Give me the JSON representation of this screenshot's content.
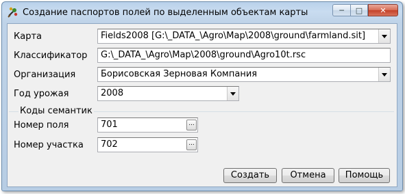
{
  "window": {
    "title": "Создание паспортов полей по выделенным объектам карты",
    "min_symbol": "─",
    "max_symbol": "□",
    "close_symbol": "✕"
  },
  "form": {
    "map": {
      "label": "Карта",
      "value": "Fields2008 [G:\\_DATA_\\Agro\\Map\\2008\\ground\\farmland.sit]"
    },
    "classifier": {
      "label": "Классификатор",
      "value": "G:\\_DATA_\\Agro\\Map\\2008\\ground\\Agro10t.rsc"
    },
    "organization": {
      "label": "Организация",
      "value": "Борисовская Зерновая Компания"
    },
    "year": {
      "label": "Год урожая",
      "value": "2008"
    }
  },
  "semantic_codes": {
    "title": "Коды семантик",
    "field_number": {
      "label": "Номер поля",
      "value": "701"
    },
    "plot_number": {
      "label": "Номер участка",
      "value": "702"
    },
    "ellipsis": "..."
  },
  "buttons": {
    "create": "Создать",
    "cancel": "Отмена",
    "help": "Помощь"
  }
}
